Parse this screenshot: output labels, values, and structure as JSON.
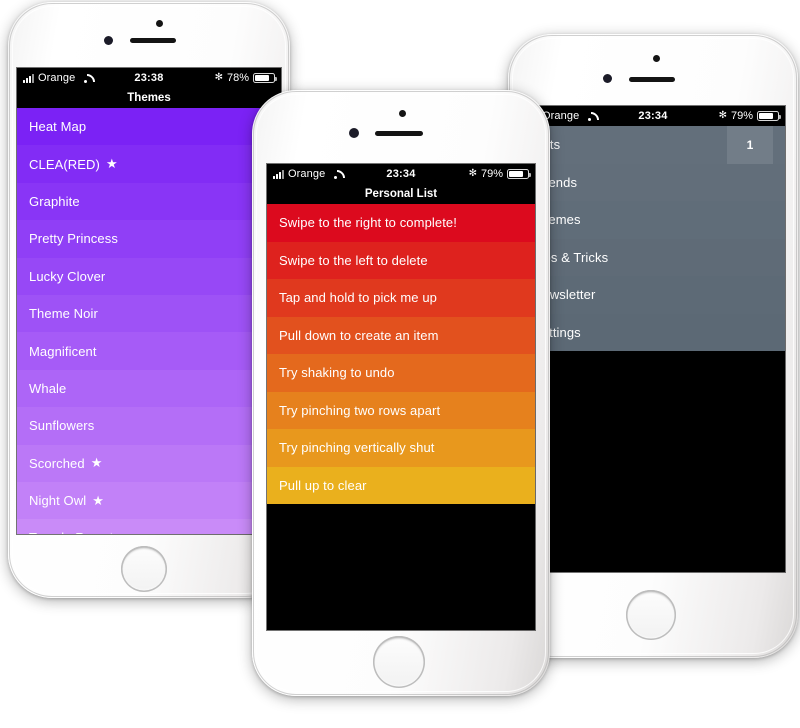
{
  "scene": {
    "description": "Three iPhone mockups showing a themed to-do list app"
  },
  "phones": [
    {
      "id": "left",
      "status_bar": {
        "carrier": "Orange",
        "signal_icon": "cellular-bars-icon",
        "wifi_icon": "wifi-icon",
        "time": "23:38",
        "bluetooth_icon": "bluetooth-icon",
        "battery_percent": "78%",
        "battery_level": 78
      },
      "nav_title": "Themes",
      "theme": {
        "gradient_start": "#7B22F5",
        "gradient_end": "#C98BF8"
      },
      "rows": [
        {
          "label": "Heat Map",
          "starred": false
        },
        {
          "label": "CLEA(RED)",
          "starred": true
        },
        {
          "label": "Graphite",
          "starred": false
        },
        {
          "label": "Pretty Princess",
          "starred": false
        },
        {
          "label": "Lucky Clover",
          "starred": false
        },
        {
          "label": "Theme Noir",
          "starred": false
        },
        {
          "label": "Magnificent",
          "starred": false
        },
        {
          "label": "Whale",
          "starred": false
        },
        {
          "label": "Sunflowers",
          "starred": false
        },
        {
          "label": "Scorched",
          "starred": true
        },
        {
          "label": "Night Owl",
          "starred": true
        },
        {
          "label": "Temple Run",
          "starred": true
        }
      ]
    },
    {
      "id": "center",
      "status_bar": {
        "carrier": "Orange",
        "signal_icon": "cellular-bars-icon",
        "wifi_icon": "wifi-icon",
        "time": "23:34",
        "bluetooth_icon": "bluetooth-icon",
        "battery_percent": "79%",
        "battery_level": 79
      },
      "nav_title": "Personal List",
      "theme": {
        "gradient_start": "#DC0A1E",
        "gradient_end": "#EAB01D"
      },
      "rows": [
        {
          "label": "Swipe to the right to complete!"
        },
        {
          "label": "Swipe to the left to delete"
        },
        {
          "label": "Tap and hold to pick me up"
        },
        {
          "label": "Pull down to create an item"
        },
        {
          "label": "Try shaking to undo"
        },
        {
          "label": "Try pinching two rows apart"
        },
        {
          "label": "Try pinching vertically shut"
        },
        {
          "label": "Pull up to clear"
        }
      ]
    },
    {
      "id": "right",
      "status_bar": {
        "carrier": "Orange",
        "signal_icon": "cellular-bars-icon",
        "wifi_icon": "wifi-icon",
        "time": "23:34",
        "bluetooth_icon": "bluetooth-icon",
        "battery_percent": "79%",
        "battery_level": 79
      },
      "nav_title": "",
      "theme": {
        "gradient_start": "#636F7B",
        "gradient_end": "#5C6975"
      },
      "rows": [
        {
          "label": "Lists",
          "badge": "1"
        },
        {
          "label": "Friends",
          "badge": ""
        },
        {
          "label": "Themes",
          "badge": ""
        },
        {
          "label": "Tips & Tricks",
          "badge": ""
        },
        {
          "label": "Newsletter",
          "badge": ""
        },
        {
          "label": "Settings",
          "badge": ""
        }
      ]
    }
  ],
  "glyphs": {
    "star": "★",
    "bluetooth": "✻"
  }
}
